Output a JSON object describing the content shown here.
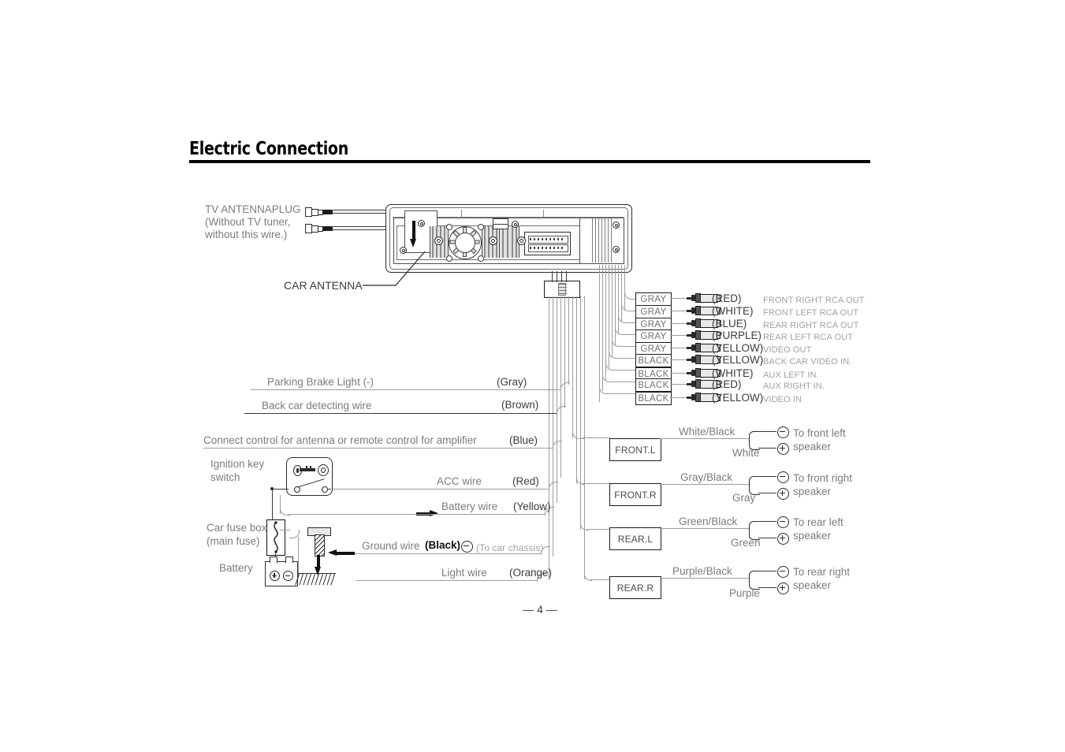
{
  "page": {
    "section_title": "Electric Connection",
    "page_number": "4",
    "page_number_display": "—  4  —"
  },
  "antenna": {
    "plug_label_line1": "TV ANTENNAPLUG",
    "plug_label_line2": "(Without TV tuner,",
    "plug_label_line3": "without this wire.)",
    "car_antenna_label": "CAR ANTENNA"
  },
  "rca_outputs": [
    {
      "box": "GRAY",
      "color": "(RED)",
      "function": "FRONT RIGHT RCA OUT"
    },
    {
      "box": "GRAY",
      "color": "(WHITE)",
      "function": "FRONT LEFT RCA OUT"
    },
    {
      "box": "GRAY",
      "color": "(BLUE)",
      "function": "REAR RIGHT RCA OUT"
    },
    {
      "box": "GRAY",
      "color": "(PURPLE)",
      "function": "REAR LEFT RCA OUT"
    },
    {
      "box": "GRAY",
      "color": "(YELLOW)",
      "function": "VIDEO OUT"
    },
    {
      "box": "BLACK",
      "color": "(YELLOW)",
      "function": "BACK CAR VIDEO IN."
    },
    {
      "box": "BLACK",
      "color": "(WHITE)",
      "function": "AUX LEFT IN."
    },
    {
      "box": "BLACK",
      "color": "(RED)",
      "function": "AUX RIGHT IN."
    },
    {
      "box": "BLACK",
      "color": "(YELLOW)",
      "function": "VIDEO IN"
    }
  ],
  "control_wires": [
    {
      "name": "Parking Brake Light (-)",
      "color": "(Gray)"
    },
    {
      "name": "Back car detecting wire",
      "color": "(Brown)"
    },
    {
      "name": "Connect control for antenna or remote control for amplifier",
      "color": "(Blue)"
    },
    {
      "name": "ACC wire",
      "color": "(Red)"
    },
    {
      "name": "Battery wire",
      "color": "(Yellow)"
    },
    {
      "name": "Light wire",
      "color": "(Orange)"
    }
  ],
  "ground_wire": {
    "name": "Ground wire",
    "color": "(Black)",
    "symbol": "minus-circle-icon",
    "note": "(To car chassis)"
  },
  "power_components": {
    "ignition_label_line1": "Ignition key",
    "ignition_label_line2": "switch",
    "fuse_label_line1": "Car fuse box",
    "fuse_label_line2": "(main fuse)",
    "battery_label": "Battery"
  },
  "speakers": [
    {
      "box": "FRONT.L",
      "neg_wire": "White/Black",
      "pos_wire": "White",
      "dest_line1": "To front left",
      "dest_line2": "speaker"
    },
    {
      "box": "FRONT.R",
      "neg_wire": "Gray/Black",
      "pos_wire": "Gray",
      "dest_line1": "To front right",
      "dest_line2": "speaker"
    },
    {
      "box": "REAR.L",
      "neg_wire": "Green/Black",
      "pos_wire": "Green",
      "dest_line1": "To rear left",
      "dest_line2": "speaker"
    },
    {
      "box": "REAR.R",
      "neg_wire": "Purple/Black",
      "pos_wire": "Purple",
      "dest_line1": "To rear right",
      "dest_line2": "speaker"
    }
  ],
  "colors": {
    "ink": "#111111",
    "label_gray": "#7c7c7c",
    "faint_gray": "#a2a2a2",
    "line_gray": "#9c9c9c"
  }
}
